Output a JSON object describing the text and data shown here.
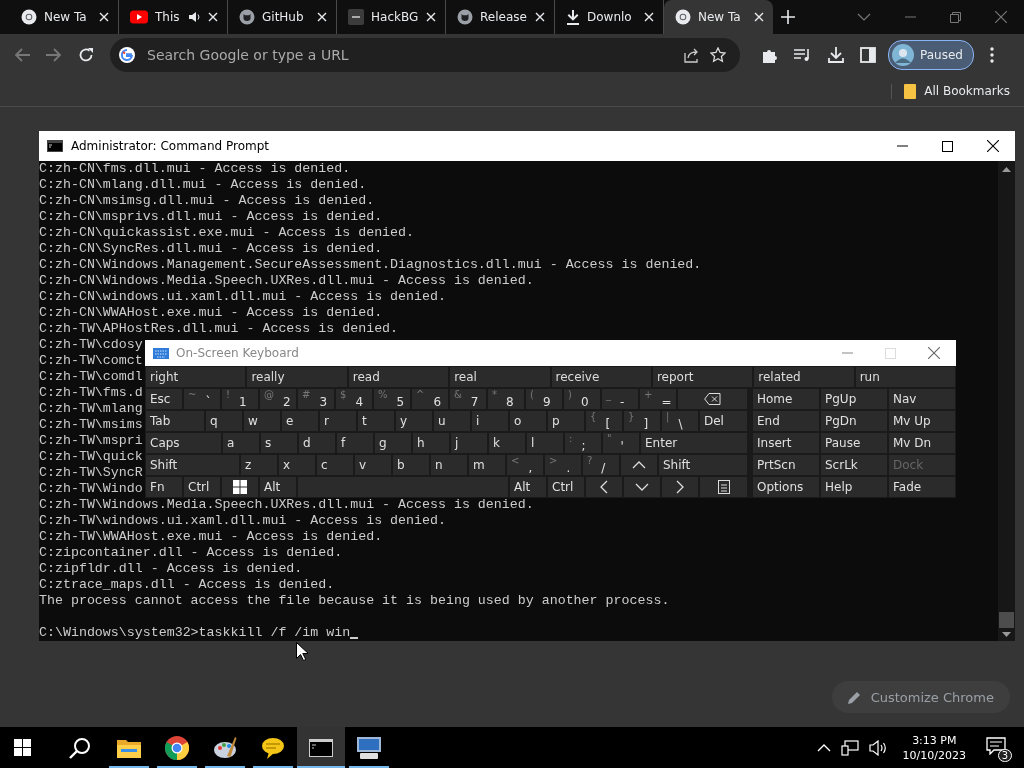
{
  "browser": {
    "tabs": [
      {
        "kind": "chrome",
        "title": "New Ta",
        "audio": false,
        "selected": false
      },
      {
        "kind": "youtube",
        "title": "This",
        "audio": true,
        "selected": false
      },
      {
        "kind": "github",
        "title": "GitHub",
        "audio": false,
        "selected": false
      },
      {
        "kind": "dash",
        "title": "HackBG",
        "audio": false,
        "selected": false
      },
      {
        "kind": "github",
        "title": "Release",
        "audio": false,
        "selected": false
      },
      {
        "kind": "download",
        "title": "Downlo",
        "audio": false,
        "selected": false
      },
      {
        "kind": "chrome",
        "title": "New Ta",
        "audio": false,
        "selected": true
      }
    ],
    "omnibox": {
      "placeholder": "Search Google or type a URL"
    },
    "profile": {
      "label": "Paused"
    },
    "bookmarks": {
      "label": "All Bookmarks"
    },
    "customize": {
      "label": "Customize Chrome"
    }
  },
  "console": {
    "title": "Administrator: Command Prompt",
    "lines": [
      "C:zh-CN\\fms.dll.mui - Access is denied.",
      "C:zh-CN\\mlang.dll.mui - Access is denied.",
      "C:zh-CN\\msimsg.dll.mui - Access is denied.",
      "C:zh-CN\\msprivs.dll.mui - Access is denied.",
      "C:zh-CN\\quickassist.exe.mui - Access is denied.",
      "C:zh-CN\\SyncRes.dll.mui - Access is denied.",
      "C:zh-CN\\Windows.Management.SecureAssessment.Diagnostics.dll.mui - Access is denied.",
      "C:zh-CN\\Windows.Media.Speech.UXRes.dll.mui - Access is denied.",
      "C:zh-CN\\windows.ui.xaml.dll.mui - Access is denied.",
      "C:zh-CN\\WWAHost.exe.mui - Access is denied.",
      "C:zh-TW\\APHostRes.dll.mui - Access is denied.",
      "C:zh-TW\\cdosy",
      "C:zh-TW\\comct",
      "C:zh-TW\\comdl",
      "C:zh-TW\\fms.d",
      "C:zh-TW\\mlang",
      "C:zh-TW\\msims",
      "C:zh-TW\\mspri",
      "C:zh-TW\\quick",
      "C:zh-TW\\SyncR",
      "C:zh-TW\\Windo",
      "C:zh-TW\\Windows.Media.Speech.UXRes.dll.mui - Access is denied.",
      "C:zh-TW\\windows.ui.xaml.dll.mui - Access is denied.",
      "C:zh-TW\\WWAHost.exe.mui - Access is denied.",
      "C:zipcontainer.dll - Access is denied.",
      "C:zipfldr.dll - Access is denied.",
      "C:ztrace_maps.dll - Access is denied.",
      "The process cannot access the file because it is being used by another process."
    ],
    "prompt": "C:\\Windows\\system32>taskkill /f /im win"
  },
  "keyboard": {
    "title": "On-Screen Keyboard",
    "suggestions": [
      "right",
      "really",
      "read",
      "real",
      "receive",
      "report",
      "related",
      "run"
    ],
    "rows": [
      [
        {
          "label": "Esc"
        },
        {
          "shift": "~",
          "label": "`"
        },
        {
          "shift": "!",
          "label": "1"
        },
        {
          "shift": "@",
          "label": "2"
        },
        {
          "shift": "#",
          "label": "3"
        },
        {
          "shift": "$",
          "label": "4"
        },
        {
          "shift": "%",
          "label": "5"
        },
        {
          "shift": "^",
          "label": "6"
        },
        {
          "shift": "&",
          "label": "7"
        },
        {
          "shift": "*",
          "label": "8"
        },
        {
          "shift": "(",
          "label": "9"
        },
        {
          "shift": ")",
          "label": "0"
        },
        {
          "shift": "_",
          "label": "-"
        },
        {
          "shift": "+",
          "label": "="
        },
        {
          "kind": "backspace"
        }
      ],
      [
        {
          "label": "Tab"
        },
        {
          "label": "q"
        },
        {
          "label": "w"
        },
        {
          "label": "e"
        },
        {
          "label": "r"
        },
        {
          "label": "t"
        },
        {
          "label": "y"
        },
        {
          "label": "u"
        },
        {
          "label": "i"
        },
        {
          "label": "o"
        },
        {
          "label": "p"
        },
        {
          "shift": "{",
          "label": "["
        },
        {
          "shift": "}",
          "label": "]"
        },
        {
          "shift": "|",
          "label": "\\"
        },
        {
          "label": "Del"
        }
      ],
      [
        {
          "label": "Caps"
        },
        {
          "label": "a"
        },
        {
          "label": "s"
        },
        {
          "label": "d"
        },
        {
          "label": "f"
        },
        {
          "label": "g"
        },
        {
          "label": "h"
        },
        {
          "label": "j"
        },
        {
          "label": "k"
        },
        {
          "label": "l"
        },
        {
          "shift": ":",
          "label": ";"
        },
        {
          "shift": "\"",
          "label": "'"
        },
        {
          "label": "Enter"
        }
      ],
      [
        {
          "label": "Shift"
        },
        {
          "label": "z"
        },
        {
          "label": "x"
        },
        {
          "label": "c"
        },
        {
          "label": "v"
        },
        {
          "label": "b"
        },
        {
          "label": "n"
        },
        {
          "label": "m"
        },
        {
          "shift": "<",
          "label": ","
        },
        {
          "shift": ">",
          "label": "."
        },
        {
          "shift": "?",
          "label": "/"
        },
        {
          "kind": "up"
        },
        {
          "label": "Shift"
        }
      ],
      [
        {
          "label": "Fn"
        },
        {
          "label": "Ctrl"
        },
        {
          "kind": "windows"
        },
        {
          "label": "Alt"
        },
        {
          "kind": "space"
        },
        {
          "label": "Alt"
        },
        {
          "label": "Ctrl"
        },
        {
          "kind": "left"
        },
        {
          "kind": "down"
        },
        {
          "kind": "right"
        },
        {
          "kind": "menu"
        }
      ]
    ],
    "nav": [
      [
        {
          "label": "Home",
          "disabled": false
        },
        {
          "label": "PgUp",
          "disabled": false
        },
        {
          "label": "Nav",
          "disabled": false
        }
      ],
      [
        {
          "label": "End",
          "disabled": false
        },
        {
          "label": "PgDn",
          "disabled": false
        },
        {
          "label": "Mv Up",
          "disabled": false
        }
      ],
      [
        {
          "label": "Insert",
          "disabled": false
        },
        {
          "label": "Pause",
          "disabled": false
        },
        {
          "label": "Mv Dn",
          "disabled": false
        }
      ],
      [
        {
          "label": "PrtScn",
          "disabled": false
        },
        {
          "label": "ScrLk",
          "disabled": false
        },
        {
          "label": "Dock",
          "disabled": true
        }
      ],
      [
        {
          "label": "Options",
          "disabled": false
        },
        {
          "label": "Help",
          "disabled": false
        },
        {
          "label": "Fade",
          "disabled": false
        }
      ]
    ]
  },
  "taskbar": {
    "apps": [
      {
        "kind": "explorer",
        "running": true,
        "selected": false
      },
      {
        "kind": "chrome",
        "running": true,
        "selected": false
      },
      {
        "kind": "paint",
        "running": true,
        "selected": false
      },
      {
        "kind": "chat",
        "running": true,
        "selected": false
      },
      {
        "kind": "terminal",
        "running": true,
        "selected": true
      },
      {
        "kind": "keyboard",
        "running": true,
        "selected": false
      }
    ],
    "time": "3:13 PM",
    "date": "10/10/2023",
    "notifications": "3"
  }
}
